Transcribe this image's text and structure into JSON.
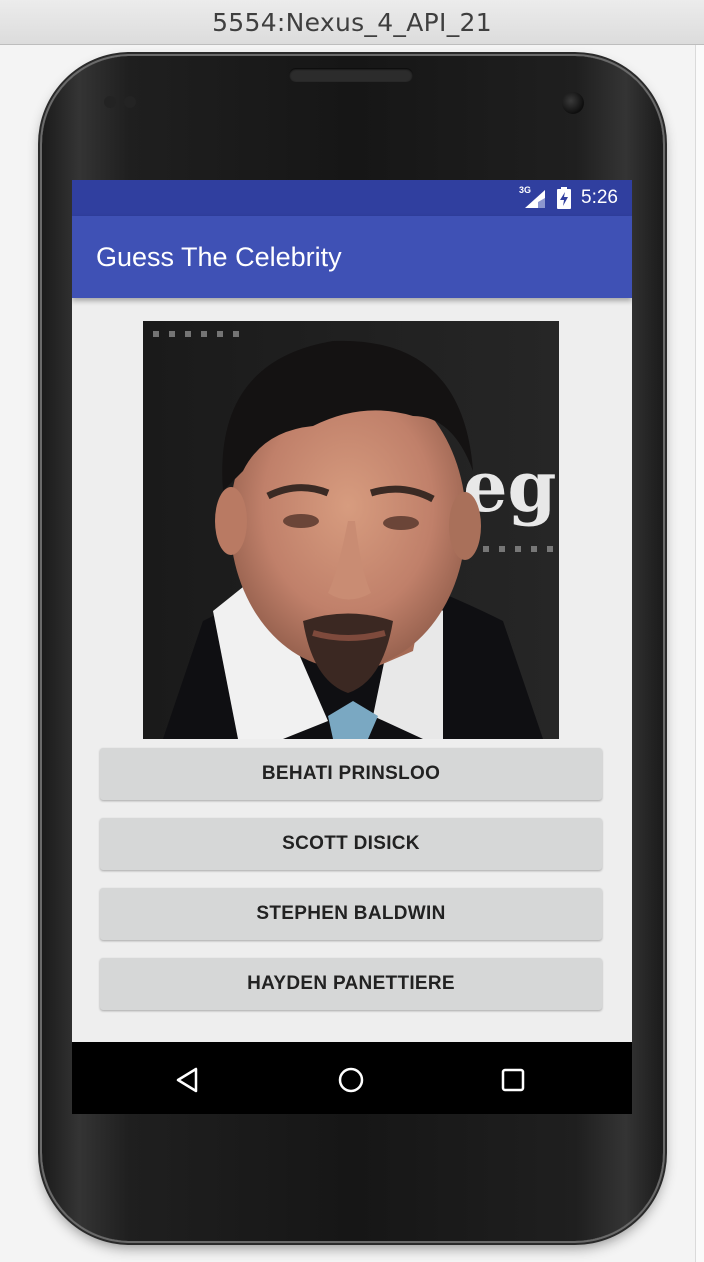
{
  "window": {
    "title": "5554:Nexus_4_API_21"
  },
  "status_bar": {
    "network": "3G",
    "time": "5:26"
  },
  "app_bar": {
    "title": "Guess The Celebrity"
  },
  "answers": [
    {
      "label": "BEHATI PRINSLOO"
    },
    {
      "label": "SCOTT DISICK"
    },
    {
      "label": "STEPHEN BALDWIN"
    },
    {
      "label": "HAYDEN PANETTIERE"
    }
  ],
  "navigation": {
    "icons": [
      "back-icon",
      "home-icon",
      "recents-icon"
    ]
  },
  "colors": {
    "status_bar": "#303f9f",
    "app_bar": "#3f51b5",
    "screen_background": "#eeeeee",
    "button_background": "#d6d7d7",
    "nav_bar": "#000000"
  }
}
